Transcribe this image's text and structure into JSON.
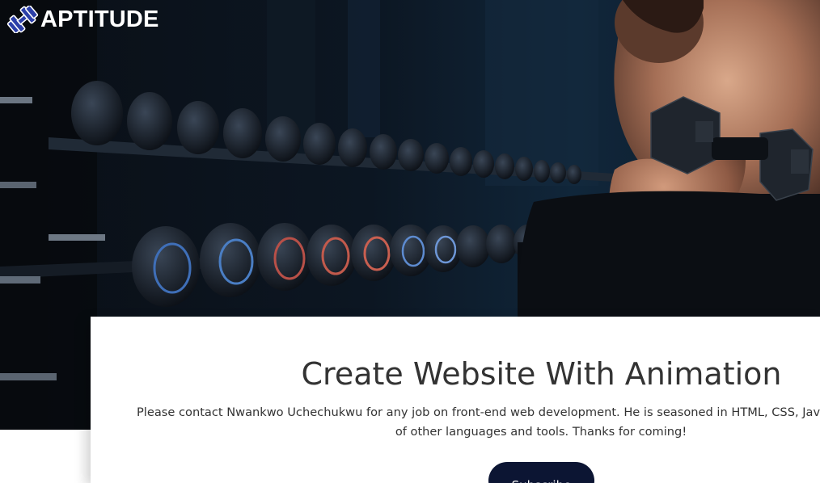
{
  "header": {
    "brand": "APTITUDE",
    "logo_icon": "dumbbell-logo-icon"
  },
  "hero": {
    "image": "gym-dumbbell-curl-photo"
  },
  "card": {
    "title": "Create Website With Animation",
    "text_line1": "Please contact Nwankwo Uchechukwu for any job on front-end web development. He is seasoned in HTML, CSS, Javascr",
    "text_line2": "of other languages and tools. Thanks for coming!",
    "button_label": "Subscribe"
  },
  "colors": {
    "button_bg": "#0c1533",
    "title_text": "#333333",
    "hero_bg": "#05070b",
    "logo_accent": "#2c3fa8"
  }
}
